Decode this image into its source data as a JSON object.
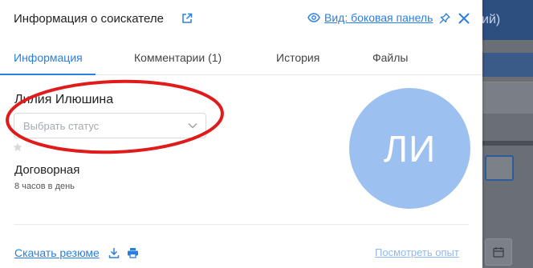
{
  "background": {
    "header_fragment": "ий)"
  },
  "panel": {
    "title": "Информация о соискателе",
    "view_link": "Вид: боковая панель",
    "tabs": [
      {
        "label": "Информация",
        "active": true
      },
      {
        "label": "Комментарии (1)",
        "active": false
      },
      {
        "label": "История",
        "active": false
      },
      {
        "label": "Файлы",
        "active": false
      }
    ],
    "candidate": {
      "name": "Лилия Илюшина",
      "status_placeholder": "Выбрать статус",
      "salary": "Договорная",
      "schedule": "8 часов в день",
      "initials": "ЛИ"
    },
    "footer": {
      "download_resume": "Скачать резюме",
      "view_experience": "Посмотреть опыт"
    }
  },
  "colors": {
    "accent": "#2a7ee0",
    "avatar": "#9cc0f0",
    "annotation": "#e01b1b",
    "overlay": "#6a6f76"
  },
  "icons": [
    "external-link-icon",
    "eye-icon",
    "pin-icon",
    "close-icon",
    "chevron-down-icon",
    "star-icon",
    "download-icon",
    "print-icon",
    "calendar-icon"
  ]
}
